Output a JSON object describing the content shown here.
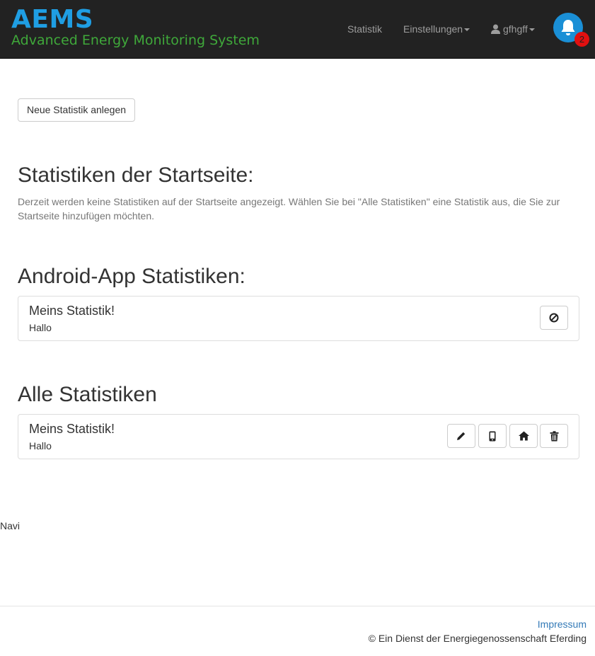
{
  "navbar": {
    "brand_title": "AEMS",
    "brand_subtitle": "Advanced Energy Monitoring System",
    "links": {
      "statistik": "Statistik",
      "einstellungen": "Einstellungen",
      "user": "gfhgff"
    },
    "notification_count": "2",
    "icons": {
      "user": "user-icon",
      "bell": "bell-icon",
      "caret": "caret-down-icon"
    }
  },
  "actions": {
    "new_statistic_label": "Neue Statistik anlegen"
  },
  "startpage_section": {
    "heading": "Statistiken der Startseite:",
    "help_text": "Derzeit werden keine Statistiken auf der Startseite angezeigt. Wählen Sie bei \"Alle Statistiken\" eine Statistik aus, die Sie zur Startseite hinzufügen möchten."
  },
  "android_section": {
    "heading": "Android-App Statistiken:",
    "items": [
      {
        "title": "Meins Statistik!",
        "description": "Hallo",
        "actions": [
          "remove-from-app-icon"
        ]
      }
    ]
  },
  "all_section": {
    "heading": "Alle Statistiken",
    "items": [
      {
        "title": "Meins Statistik!",
        "description": "Hallo",
        "actions": [
          "edit-icon",
          "mobile-icon",
          "home-icon",
          "trash-icon"
        ]
      }
    ]
  },
  "navi_text": "Navi",
  "footer": {
    "impressum": "Impressum",
    "copyright": "© Ein Dienst der Energiegenossenschaft Eferding"
  },
  "colors": {
    "navbar_bg": "#222222",
    "brand_blue": "#1f9ee3",
    "brand_green": "#3fa83a",
    "badge_red": "#e01010",
    "link_blue": "#337ab7"
  }
}
